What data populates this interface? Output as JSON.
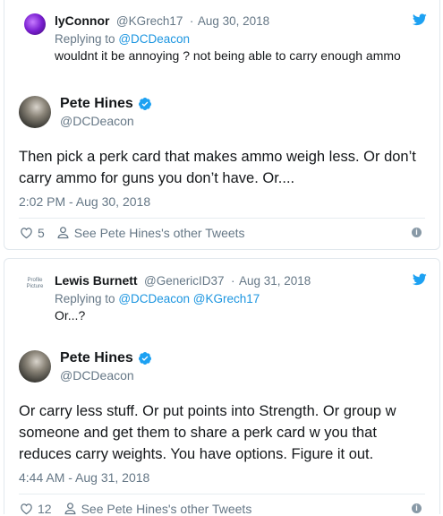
{
  "colors": {
    "link": "#1b95e0",
    "muted": "#657786",
    "text": "#14171a",
    "twitter_blue": "#1da1f2"
  },
  "thread": [
    {
      "reply": {
        "name": "lyConnor",
        "handle": "@KGrech17",
        "date": "Aug 30, 2018",
        "replying_prefix": "Replying to",
        "replying_to": "@DCDeacon",
        "text": "wouldnt it be annoying ? not being able to carry enough ammo",
        "avatar": "purple-abstract-avatar"
      },
      "main": {
        "name": "Pete Hines",
        "handle": "@DCDeacon",
        "text": "Then pick a perk card that makes ammo weigh less. Or don’t carry ammo for guns you don’t have. Or....",
        "timestamp": "2:02 PM - Aug 30, 2018",
        "likes": "5",
        "see_other": "See Pete Hines's other Tweets"
      }
    },
    {
      "reply": {
        "name": "Lewis Burnett",
        "handle": "@GenericID37",
        "date": "Aug 31, 2018",
        "replying_prefix": "Replying to",
        "replying_to": "@DCDeacon @KGrech17",
        "text": "Or...?",
        "avatar_alt": "Profile Picture"
      },
      "main": {
        "name": "Pete Hines",
        "handle": "@DCDeacon",
        "text": "Or carry less stuff. Or put points into Strength. Or group w someone and get them to share a perk card w you that reduces carry weights. You have options. Figure it out.",
        "timestamp": "4:44 AM - Aug 31, 2018",
        "likes": "12",
        "see_other": "See Pete Hines's other Tweets"
      }
    }
  ]
}
